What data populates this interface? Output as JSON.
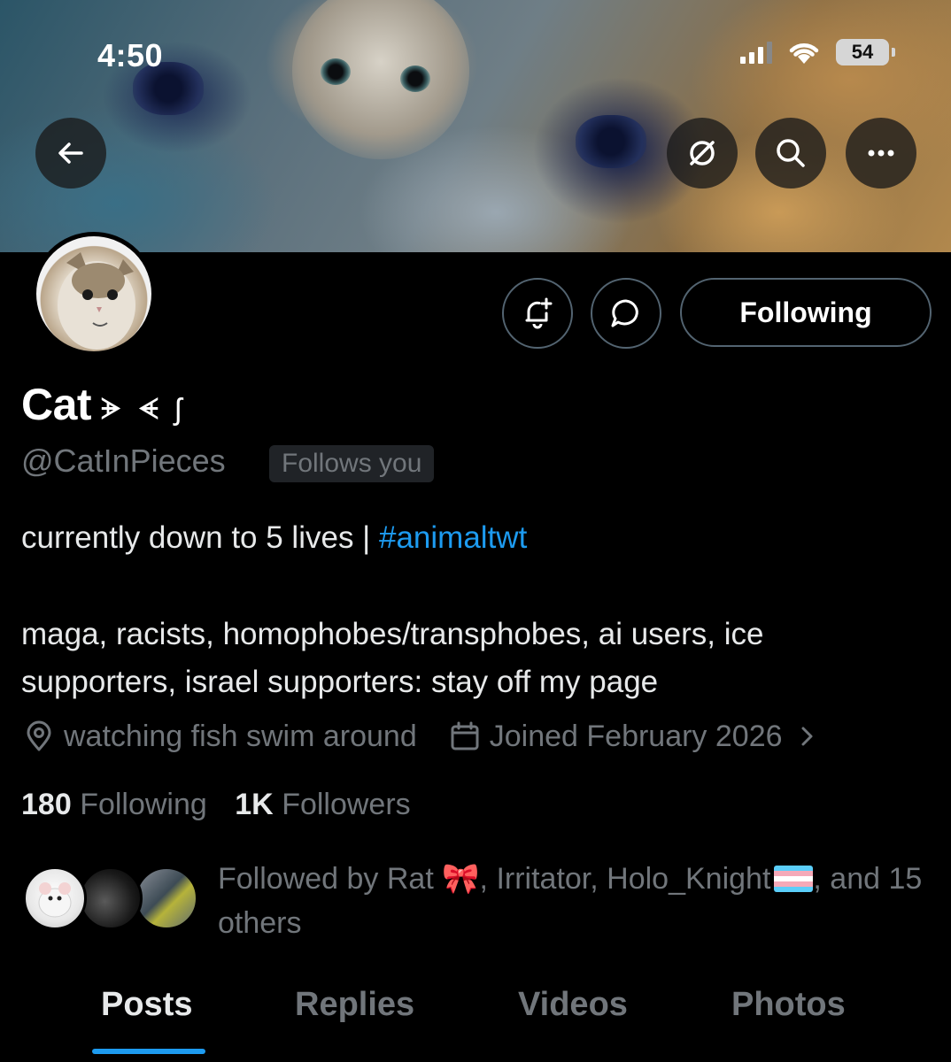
{
  "status_bar": {
    "time": "4:50",
    "battery": "54"
  },
  "profile": {
    "name": "Cat",
    "name_glyphs": "ᗘ ᗛ ʃ",
    "handle": "@CatInPieces",
    "follows_you": "Follows you",
    "bio_line1_text": "currently down to 5 lives | ",
    "bio_hashtag": "#animaltwt",
    "bio_line2": "maga, racists, homophobes/transphobes, ai users, ice",
    "bio_line3": "supporters, israel supporters: stay off my page",
    "location": "watching fish swim around",
    "joined": "Joined February 2026",
    "following_count": "180",
    "following_label": "Following",
    "followers_count": "1K",
    "followers_label": "Followers",
    "followed_by_text": "Followed by Rat 🎀, Irritator, Holo_Knight",
    "followed_by_end": ", and 15 others",
    "follow_button": "Following"
  },
  "tabs": [
    "Posts",
    "Replies",
    "Videos",
    "Photos"
  ],
  "active_tab": "Posts",
  "colors": {
    "accent": "#1d9bf0",
    "background": "#000000",
    "muted": "#71767b"
  },
  "icons": [
    "back-arrow-icon",
    "grok-icon",
    "search-icon",
    "more-icon",
    "bell-plus-icon",
    "message-icon",
    "location-icon",
    "calendar-icon",
    "chevron-right-icon"
  ]
}
